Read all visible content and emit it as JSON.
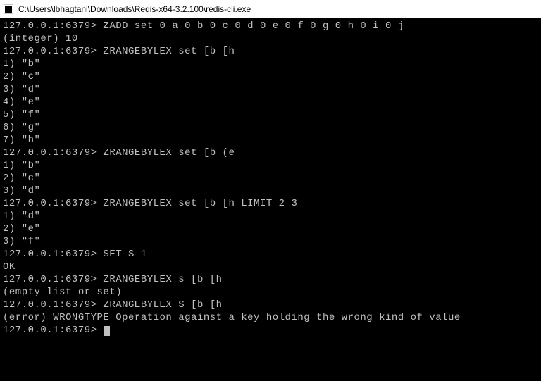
{
  "titlebar": {
    "path": "C:\\Users\\lbhagtani\\Downloads\\Redis-x64-3.2.100\\redis-cli.exe"
  },
  "prompt": "127.0.0.1:6379>",
  "session": [
    {
      "prompt": true,
      "cmd": "ZADD set 0 a 0 b 0 c 0 d 0 e 0 f 0 g 0 h 0 i 0 j"
    },
    {
      "out": "(integer) 10"
    },
    {
      "prompt": true,
      "cmd": "ZRANGEBYLEX set [b [h"
    },
    {
      "out": "1) \"b\""
    },
    {
      "out": "2) \"c\""
    },
    {
      "out": "3) \"d\""
    },
    {
      "out": "4) \"e\""
    },
    {
      "out": "5) \"f\""
    },
    {
      "out": "6) \"g\""
    },
    {
      "out": "7) \"h\""
    },
    {
      "prompt": true,
      "cmd": "ZRANGEBYLEX set [b (e"
    },
    {
      "out": "1) \"b\""
    },
    {
      "out": "2) \"c\""
    },
    {
      "out": "3) \"d\""
    },
    {
      "prompt": true,
      "cmd": "ZRANGEBYLEX set [b [h LIMIT 2 3"
    },
    {
      "out": "1) \"d\""
    },
    {
      "out": "2) \"e\""
    },
    {
      "out": "3) \"f\""
    },
    {
      "prompt": true,
      "cmd": "SET S 1"
    },
    {
      "out": "OK"
    },
    {
      "prompt": true,
      "cmd": "ZRANGEBYLEX s [b [h"
    },
    {
      "out": "(empty list or set)"
    },
    {
      "prompt": true,
      "cmd": "ZRANGEBYLEX S [b [h"
    },
    {
      "out": "(error) WRONGTYPE Operation against a key holding the wrong kind of value"
    },
    {
      "prompt": true,
      "cmd": "",
      "cursor": true
    }
  ]
}
